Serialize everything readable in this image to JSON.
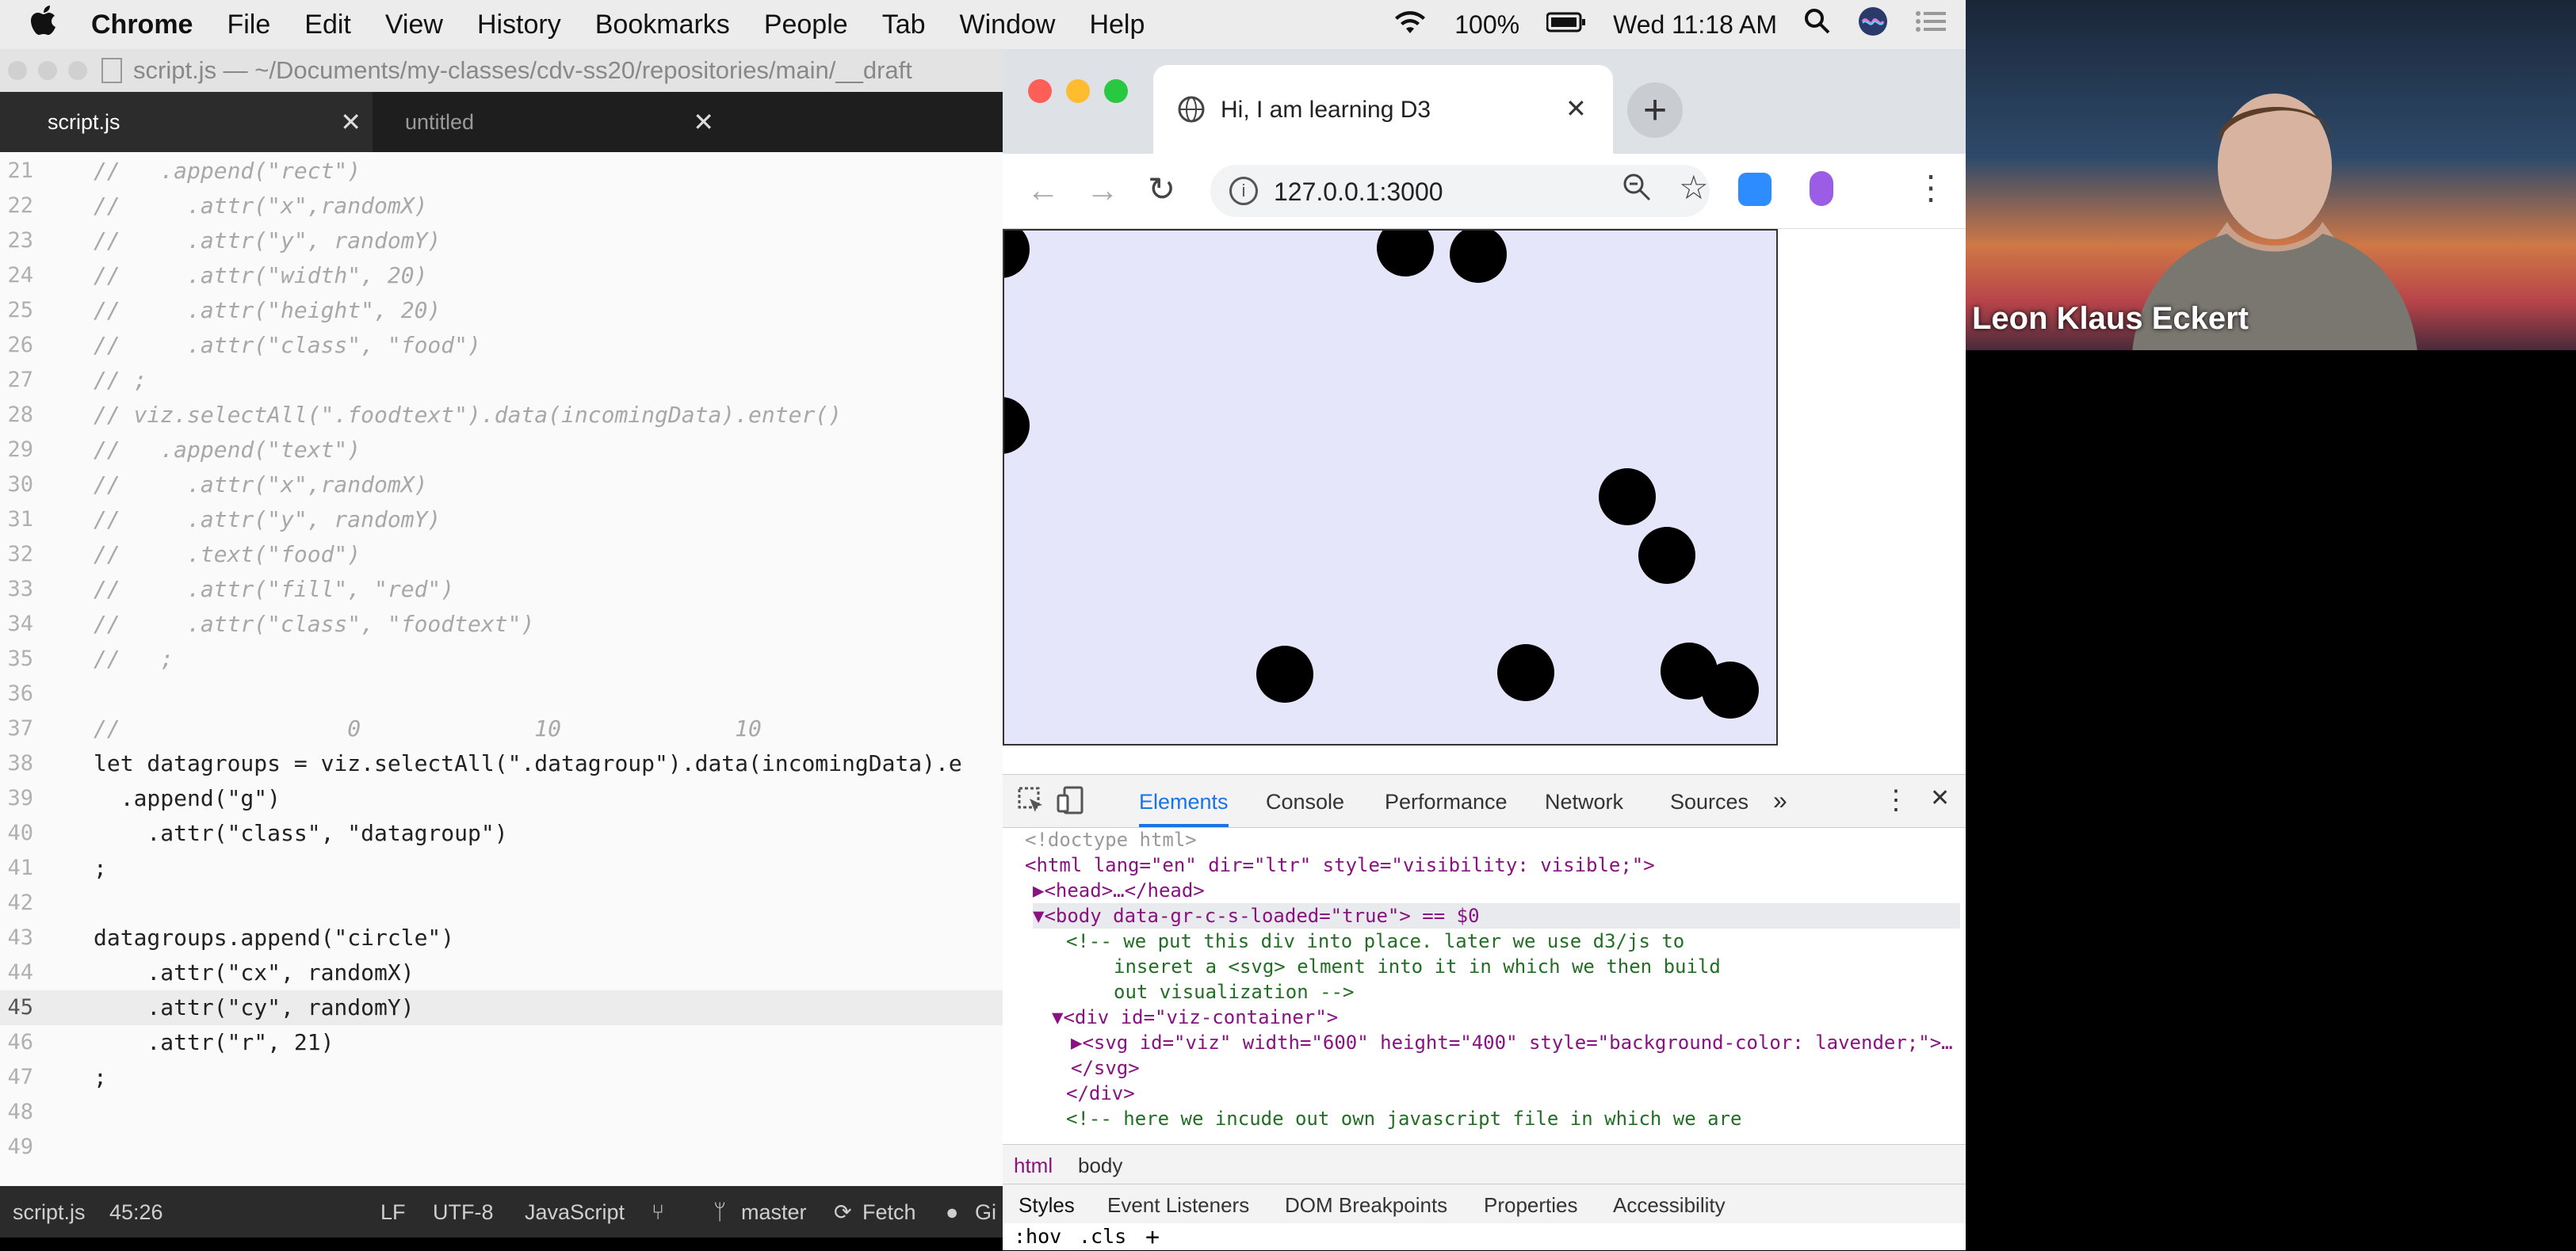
{
  "menubar": {
    "items": [
      "Chrome",
      "File",
      "Edit",
      "View",
      "History",
      "Bookmarks",
      "People",
      "Tab",
      "Window",
      "Help"
    ],
    "battery": "100%",
    "clock": "Wed 11:18 AM"
  },
  "editor": {
    "window_title": "script.js — ~/Documents/my-classes/cdv-ss20/repositories/main/__draft",
    "tabs": [
      {
        "label": "script.js",
        "active": true
      },
      {
        "label": "untitled",
        "active": false
      }
    ],
    "lines": [
      {
        "n": "21",
        "text": "//   .append(\"rect\")"
      },
      {
        "n": "22",
        "text": "//     .attr(\"x\",randomX)"
      },
      {
        "n": "23",
        "text": "//     .attr(\"y\", randomY)"
      },
      {
        "n": "24",
        "text": "//     .attr(\"width\", 20)"
      },
      {
        "n": "25",
        "text": "//     .attr(\"height\", 20)"
      },
      {
        "n": "26",
        "text": "//     .attr(\"class\", \"food\")"
      },
      {
        "n": "27",
        "text": "// ;"
      },
      {
        "n": "28",
        "text": "// viz.selectAll(\".foodtext\").data(incomingData).enter()"
      },
      {
        "n": "29",
        "text": "//   .append(\"text\")"
      },
      {
        "n": "30",
        "text": "//     .attr(\"x\",randomX)"
      },
      {
        "n": "31",
        "text": "//     .attr(\"y\", randomY)"
      },
      {
        "n": "32",
        "text": "//     .text(\"food\")"
      },
      {
        "n": "33",
        "text": "//     .attr(\"fill\", \"red\")"
      },
      {
        "n": "34",
        "text": "//     .attr(\"class\", \"foodtext\")"
      },
      {
        "n": "35",
        "text": "//   ;"
      },
      {
        "n": "36",
        "text": ""
      },
      {
        "n": "37",
        "text": "//                 0             10             10"
      },
      {
        "n": "38",
        "text": "let datagroups = viz.selectAll(\".datagroup\").data(incomingData).e"
      },
      {
        "n": "39",
        "text": "  .append(\"g\")"
      },
      {
        "n": "40",
        "text": "    .attr(\"class\", \"datagroup\")"
      },
      {
        "n": "41",
        "text": ";"
      },
      {
        "n": "42",
        "text": ""
      },
      {
        "n": "43",
        "text": "datagroups.append(\"circle\")"
      },
      {
        "n": "44",
        "text": "    .attr(\"cx\", randomX)"
      },
      {
        "n": "45",
        "text": "    .attr(\"cy\", randomY)"
      },
      {
        "n": "46",
        "text": "    .attr(\"r\", 21)"
      },
      {
        "n": "47",
        "text": ";"
      },
      {
        "n": "48",
        "text": ""
      },
      {
        "n": "49",
        "text": ""
      }
    ],
    "status": {
      "file": "script.js",
      "cursor": "45:26",
      "line_ending": "LF",
      "encoding": "UTF-8",
      "grammar": "JavaScript",
      "branch": "master",
      "fetch": "Fetch",
      "github": "Gi"
    }
  },
  "browser": {
    "tab_title": "Hi, I am learning D3",
    "url": "127.0.0.1:3000",
    "viz_background": "#e6e6fa",
    "devtools": {
      "tabs": [
        "Elements",
        "Console",
        "Performance",
        "Network",
        "Sources"
      ],
      "active_tab": "Elements",
      "dom_lines": [
        "<!doctype html>",
        "<html lang=\"en\" dir=\"ltr\" style=\"visibility: visible;\">",
        "▶<head>…</head>",
        "▼<body data-gr-c-s-loaded=\"true\"> == $0",
        "<!-- we put this div into place. later we use d3/js to",
        "inseret a <svg> elment into it in which we then build",
        "out visualization -->",
        "▼<div id=\"viz-container\">",
        "▶<svg id=\"viz\" width=\"600\" height=\"400\" style=\"background-color: lavender;\">…",
        "</svg>",
        "</div>",
        "<!-- here we incude out own javascript file in which we are"
      ],
      "breadcrumbs": [
        "html",
        "body"
      ],
      "style_tabs": [
        "Styles",
        "Event Listeners",
        "DOM Breakpoints",
        "Properties",
        "Accessibility"
      ],
      "filter_buttons": [
        ":hov",
        ".cls",
        "+"
      ]
    }
  },
  "webcam": {
    "name": "Leon Klaus Eckert"
  }
}
